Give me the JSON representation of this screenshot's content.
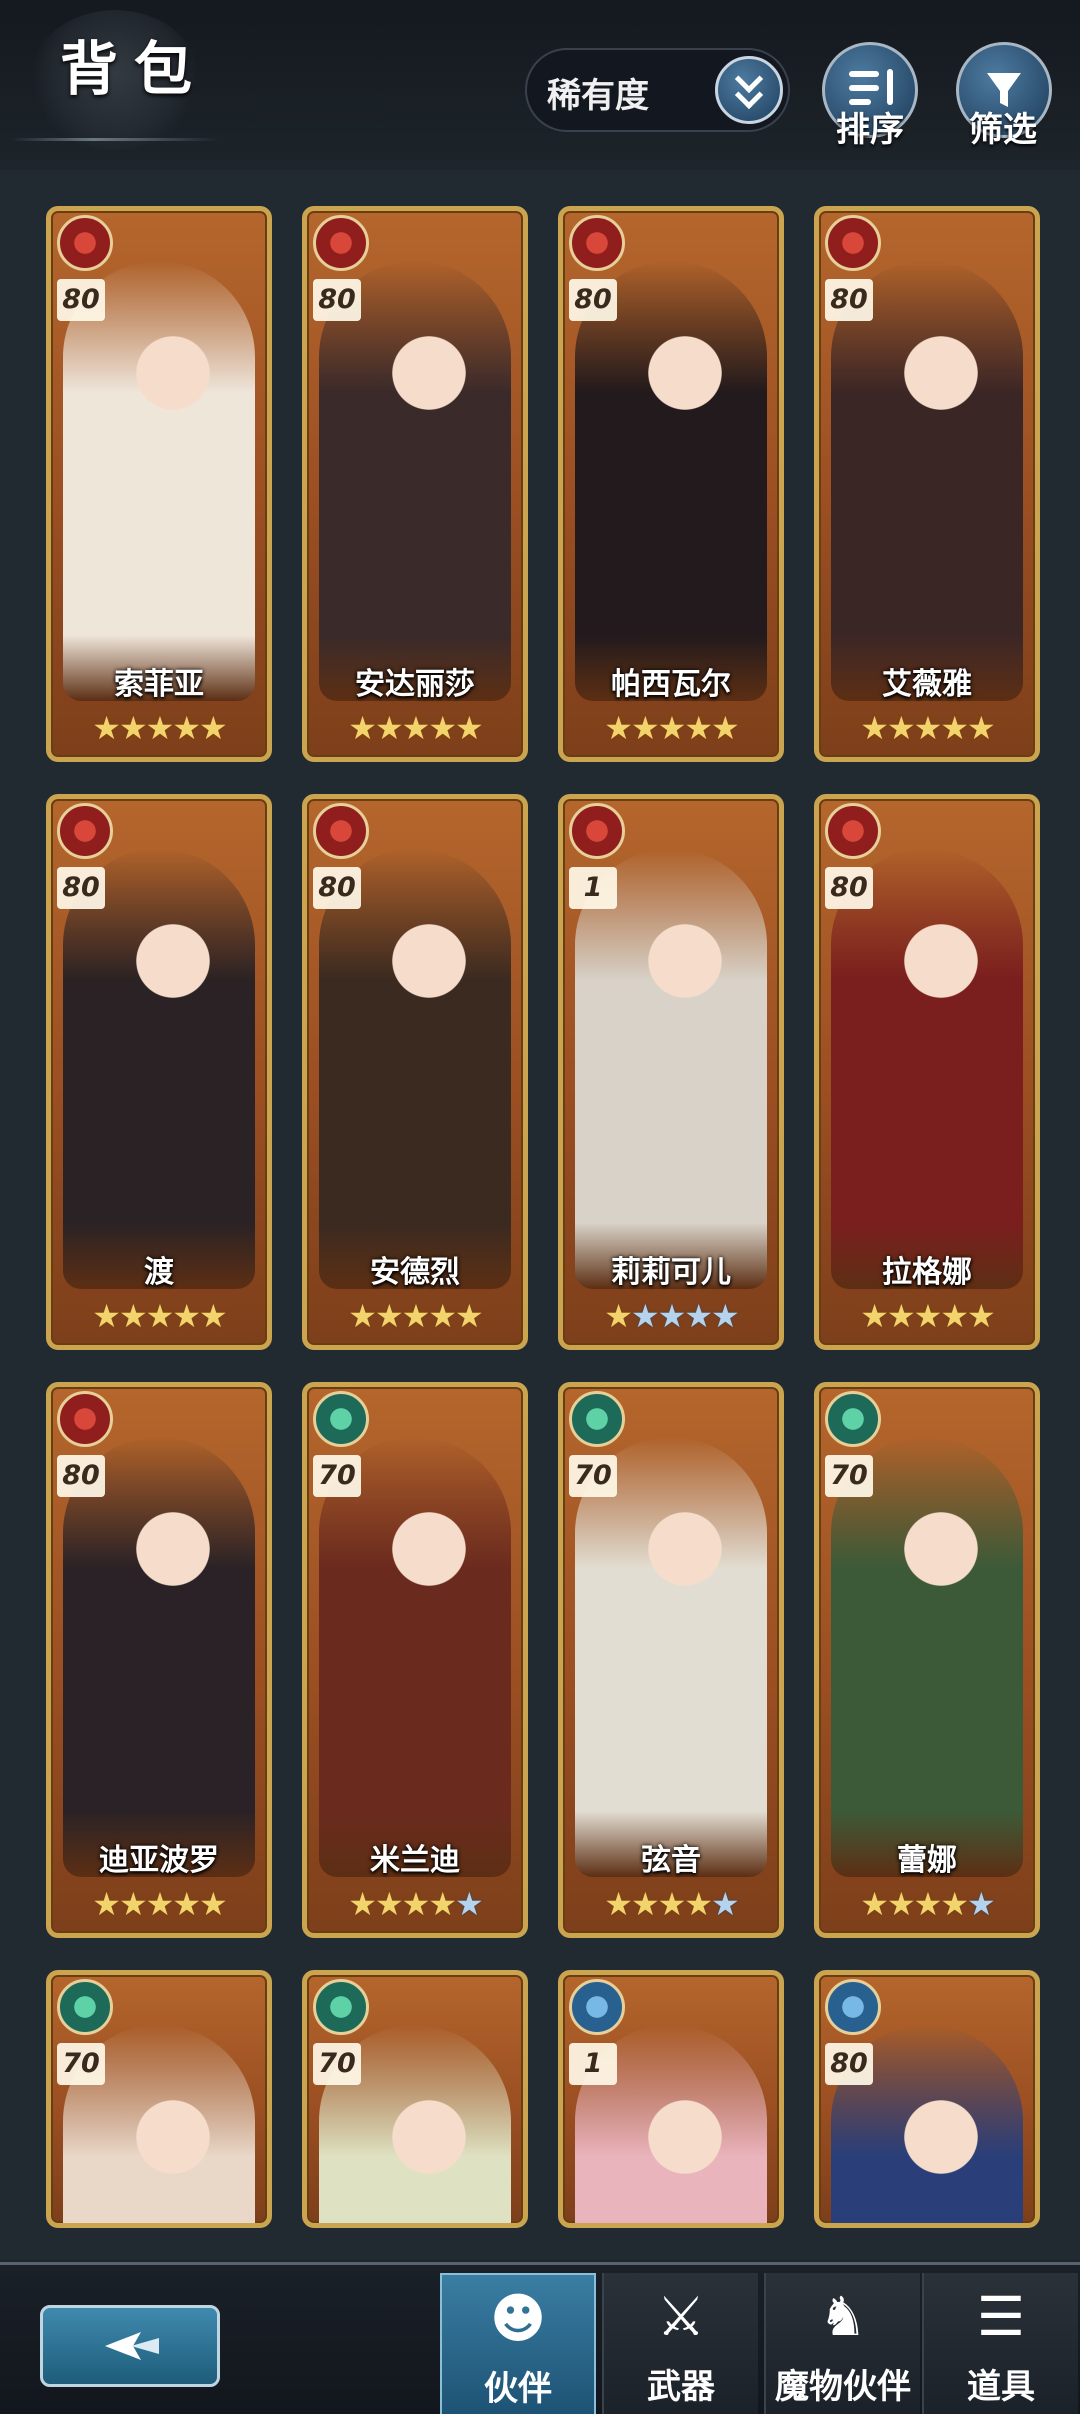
{
  "header": {
    "title": "背包",
    "rarity_dropdown": "稀有度",
    "sort_label": "排序",
    "filter_label": "筛选"
  },
  "colors": {
    "card_border": "#caa44e",
    "card_bg": "#a4552a",
    "active_tab": "#2f6f93",
    "star_gold": "#f3d36b",
    "star_blue": "#b6d3ee"
  },
  "companions": [
    {
      "name": "索菲亚",
      "level": "80",
      "element": "fire",
      "stars_gold": 5,
      "stars_blue": 0,
      "art": "#efe6da"
    },
    {
      "name": "安达丽莎",
      "level": "80",
      "element": "fire",
      "stars_gold": 5,
      "stars_blue": 0,
      "art": "#3a2a2a"
    },
    {
      "name": "帕西瓦尔",
      "level": "80",
      "element": "fire",
      "stars_gold": 5,
      "stars_blue": 0,
      "art": "#221a1c"
    },
    {
      "name": "艾薇雅",
      "level": "80",
      "element": "fire",
      "stars_gold": 5,
      "stars_blue": 0,
      "art": "#3b2626"
    },
    {
      "name": "渡",
      "level": "80",
      "element": "fire",
      "stars_gold": 5,
      "stars_blue": 0,
      "art": "#2a2224"
    },
    {
      "name": "安德烈",
      "level": "80",
      "element": "fire",
      "stars_gold": 5,
      "stars_blue": 0,
      "art": "#3a2a20"
    },
    {
      "name": "莉莉可儿",
      "level": "1",
      "element": "fire",
      "stars_gold": 1,
      "stars_blue": 4,
      "art": "#d8d2c8"
    },
    {
      "name": "拉格娜",
      "level": "80",
      "element": "fire",
      "stars_gold": 5,
      "stars_blue": 0,
      "art": "#7a1e1e"
    },
    {
      "name": "迪亚波罗",
      "level": "80",
      "element": "fire",
      "stars_gold": 5,
      "stars_blue": 0,
      "art": "#2a2226"
    },
    {
      "name": "米兰迪",
      "level": "70",
      "element": "wind",
      "stars_gold": 4,
      "stars_blue": 1,
      "art": "#6a2a1e"
    },
    {
      "name": "弦音",
      "level": "70",
      "element": "wind",
      "stars_gold": 4,
      "stars_blue": 1,
      "art": "#e2ddd2"
    },
    {
      "name": "蕾娜",
      "level": "70",
      "element": "wind",
      "stars_gold": 4,
      "stars_blue": 1,
      "art": "#3c5a38"
    },
    {
      "name": "",
      "level": "70",
      "element": "wind",
      "stars_gold": 0,
      "stars_blue": 0,
      "art": "#e9d8c8"
    },
    {
      "name": "",
      "level": "70",
      "element": "wind",
      "stars_gold": 0,
      "stars_blue": 0,
      "art": "#dfe2c2"
    },
    {
      "name": "",
      "level": "1",
      "element": "water",
      "stars_gold": 0,
      "stars_blue": 0,
      "art": "#eab4bd"
    },
    {
      "name": "",
      "level": "80",
      "element": "water",
      "stars_gold": 0,
      "stars_blue": 0,
      "art": "#2a3f7a"
    }
  ],
  "bottom_nav": {
    "tabs": [
      {
        "label": "伙伴",
        "icon": "companion-icon",
        "glyph": "☻",
        "active": true
      },
      {
        "label": "武器",
        "icon": "swords-icon",
        "glyph": "⚔",
        "active": false
      },
      {
        "label": "魔物伙伴",
        "icon": "monster-icon",
        "glyph": "♞",
        "active": false
      },
      {
        "label": "道具",
        "icon": "bag-icon",
        "glyph": "☰",
        "active": false
      }
    ]
  }
}
